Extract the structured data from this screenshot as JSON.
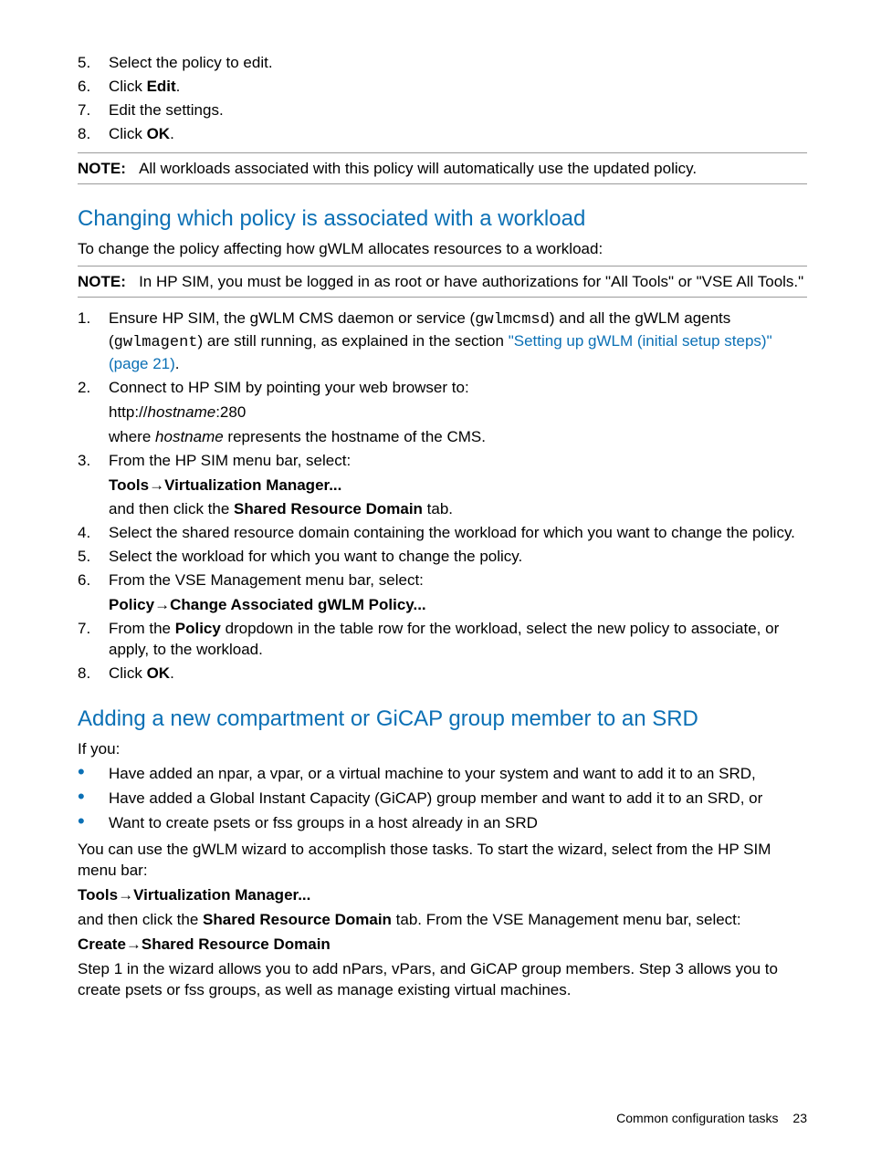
{
  "top_steps": {
    "s5": {
      "num": "5.",
      "text": "Select the policy to edit."
    },
    "s6": {
      "num": "6.",
      "pre": "Click ",
      "bold": "Edit",
      "post": "."
    },
    "s7": {
      "num": "7.",
      "text": "Edit the settings."
    },
    "s8": {
      "num": "8.",
      "pre": "Click ",
      "bold": "OK",
      "post": "."
    }
  },
  "note1": {
    "label": "NOTE:",
    "text": "All workloads associated with this policy will automatically use the updated policy."
  },
  "sec1": {
    "heading": "Changing which policy is associated with a workload",
    "intro": "To change the policy affecting how gWLM allocates resources to a workload:"
  },
  "note2": {
    "label": "NOTE:",
    "text": "In HP SIM, you must be logged in as root or have authorizations for \"All Tools\" or \"VSE All Tools.\""
  },
  "steps2": {
    "s1": {
      "num": "1.",
      "p1a": "Ensure HP SIM, the gWLM CMS daemon or service (",
      "p1m1": "gwlmcmsd",
      "p1b": ") and all the gWLM agents (",
      "p1m2": "gwlmagent",
      "p1c": ") are still running, as explained in the section ",
      "link": "\"Setting up gWLM (initial setup steps)\" (page 21)",
      "p1d": "."
    },
    "s2": {
      "num": "2.",
      "l1": "Connect to HP SIM by pointing your web browser to:",
      "l2a": "http://",
      "l2i": "hostname",
      "l2b": ":280",
      "l3a": "where ",
      "l3i": "hostname",
      "l3b": " represents the hostname of the CMS."
    },
    "s3": {
      "num": "3.",
      "l1": "From the HP SIM menu bar, select:",
      "l2b1": "Tools",
      "l2b2": "Virtualization Manager...",
      "l3a": "and then click the ",
      "l3b": "Shared Resource Domain",
      "l3c": " tab."
    },
    "s4": {
      "num": "4.",
      "text": "Select the shared resource domain containing the workload for which you want to change the policy."
    },
    "s5": {
      "num": "5.",
      "text": "Select the workload for which you want to change the policy."
    },
    "s6": {
      "num": "6.",
      "l1": "From the VSE Management menu bar, select:",
      "l2b1": "Policy",
      "l2b2": "Change Associated gWLM Policy..."
    },
    "s7": {
      "num": "7.",
      "a": "From the ",
      "b": "Policy",
      "c": " dropdown in the table row for the workload, select the new policy to associate, or apply, to the workload."
    },
    "s8": {
      "num": "8.",
      "pre": "Click ",
      "bold": "OK",
      "post": "."
    }
  },
  "sec2": {
    "heading": "Adding a new compartment or GiCAP group member to an SRD",
    "intro": "If you:"
  },
  "bullets": {
    "b1": "Have added an npar, a vpar, or a virtual machine to your system and want to add it to an SRD,",
    "b2": "Have added a Global Instant Capacity (GiCAP) group member and want to add it to an SRD, or",
    "b3": "Want to create psets or fss groups in a host already in an SRD"
  },
  "after_bullets": {
    "p1": "You can use the gWLM wizard to accomplish those tasks. To start the wizard, select from the HP SIM menu bar:",
    "p2b1": "Tools",
    "p2b2": "Virtualization Manager...",
    "p3a": "and then click the ",
    "p3b": "Shared Resource Domain",
    "p3c": " tab. From the VSE Management menu bar, select:",
    "p4b1": "Create",
    "p4b2": "Shared Resource Domain",
    "p5": "Step 1 in the wizard allows you to add nPars, vPars, and GiCAP group members. Step 3 allows you to create psets or fss groups, as well as manage existing virtual machines."
  },
  "footer": {
    "title": "Common configuration tasks",
    "page": "23"
  },
  "arrow": "→"
}
